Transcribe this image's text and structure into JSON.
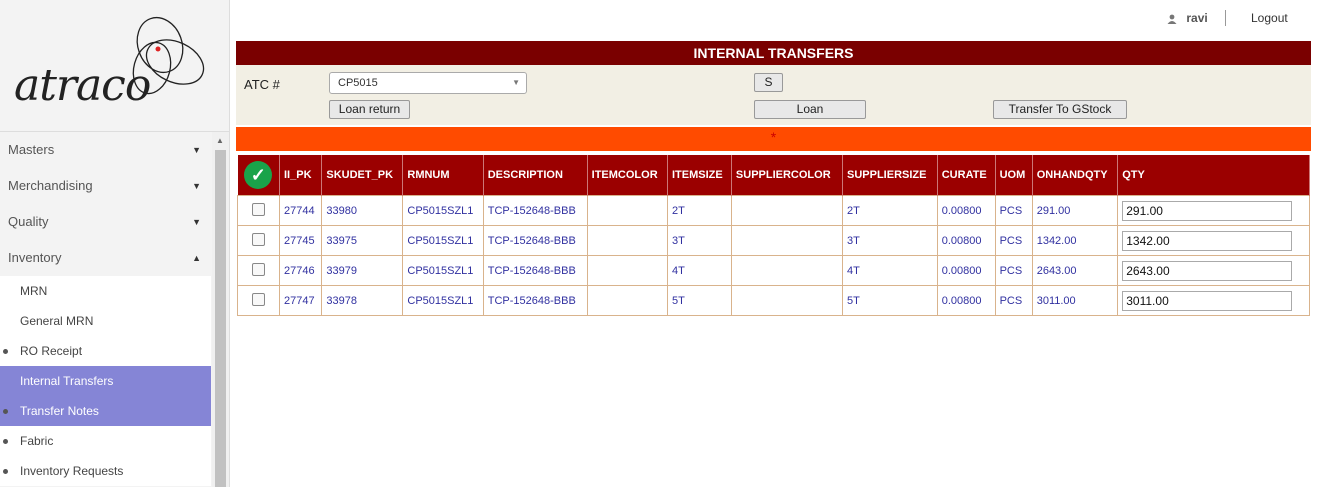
{
  "brand": {
    "logo_text": "atraco"
  },
  "user": {
    "name": "ravi",
    "logout_label": "Logout"
  },
  "sidebar": {
    "menus": [
      {
        "label": "Masters",
        "expanded": false
      },
      {
        "label": "Merchandising",
        "expanded": false
      },
      {
        "label": "Quality",
        "expanded": false
      },
      {
        "label": "Inventory",
        "expanded": true
      }
    ],
    "subitems": [
      {
        "label": "MRN",
        "bullet": false,
        "active": false
      },
      {
        "label": "General MRN",
        "bullet": false,
        "active": false
      },
      {
        "label": "RO Receipt",
        "bullet": true,
        "active": false
      },
      {
        "label": "Internal Transfers",
        "bullet": false,
        "active": true
      },
      {
        "label": "Transfer Notes",
        "bullet": true,
        "active": true
      },
      {
        "label": "Fabric",
        "bullet": true,
        "active": false
      },
      {
        "label": "Inventory Requests",
        "bullet": true,
        "active": false
      }
    ]
  },
  "panel": {
    "title": "INTERNAL TRANSFERS",
    "atc_label": "ATC #",
    "atc_value": "CP5015",
    "s_button": "S",
    "loan_return_button": "Loan return",
    "loan_button": "Loan",
    "transfer_button": "Transfer To  GStock",
    "error_marker": "*"
  },
  "table": {
    "columns": [
      "II_PK",
      "SKUDET_PK",
      "RMNUM",
      "DESCRIPTION",
      "ITEMCOLOR",
      "ITEMSIZE",
      "SUPPLIERCOLOR",
      "SUPPLIERSIZE",
      "CURATE",
      "UOM",
      "ONHANDQTY",
      "QTY"
    ],
    "rows": [
      {
        "ii_pk": "27744",
        "skudet_pk": "33980",
        "rmnum": "CP5015SZL1",
        "description": "TCP-152648-BBB",
        "itemcolor": "",
        "itemsize": "2T",
        "suppliercolor": "",
        "suppliersize": "2T",
        "curate": "0.00800",
        "uom": "PCS",
        "onhandqty": "291.00",
        "qty": "291.00"
      },
      {
        "ii_pk": "27745",
        "skudet_pk": "33975",
        "rmnum": "CP5015SZL1",
        "description": "TCP-152648-BBB",
        "itemcolor": "",
        "itemsize": "3T",
        "suppliercolor": "",
        "suppliersize": "3T",
        "curate": "0.00800",
        "uom": "PCS",
        "onhandqty": "1342.00",
        "qty": "1342.00"
      },
      {
        "ii_pk": "27746",
        "skudet_pk": "33979",
        "rmnum": "CP5015SZL1",
        "description": "TCP-152648-BBB",
        "itemcolor": "",
        "itemsize": "4T",
        "suppliercolor": "",
        "suppliersize": "4T",
        "curate": "0.00800",
        "uom": "PCS",
        "onhandqty": "2643.00",
        "qty": "2643.00"
      },
      {
        "ii_pk": "27747",
        "skudet_pk": "33978",
        "rmnum": "CP5015SZL1",
        "description": "TCP-152648-BBB",
        "itemcolor": "",
        "itemsize": "5T",
        "suppliercolor": "",
        "suppliersize": "5T",
        "curate": "0.00800",
        "uom": "PCS",
        "onhandqty": "3011.00",
        "qty": "3011.00"
      }
    ]
  },
  "colors": {
    "title_bar": "#7a0000",
    "header_row": "#9b0000",
    "error_bar": "#ff4b00",
    "active_menu": "#8585d6"
  }
}
